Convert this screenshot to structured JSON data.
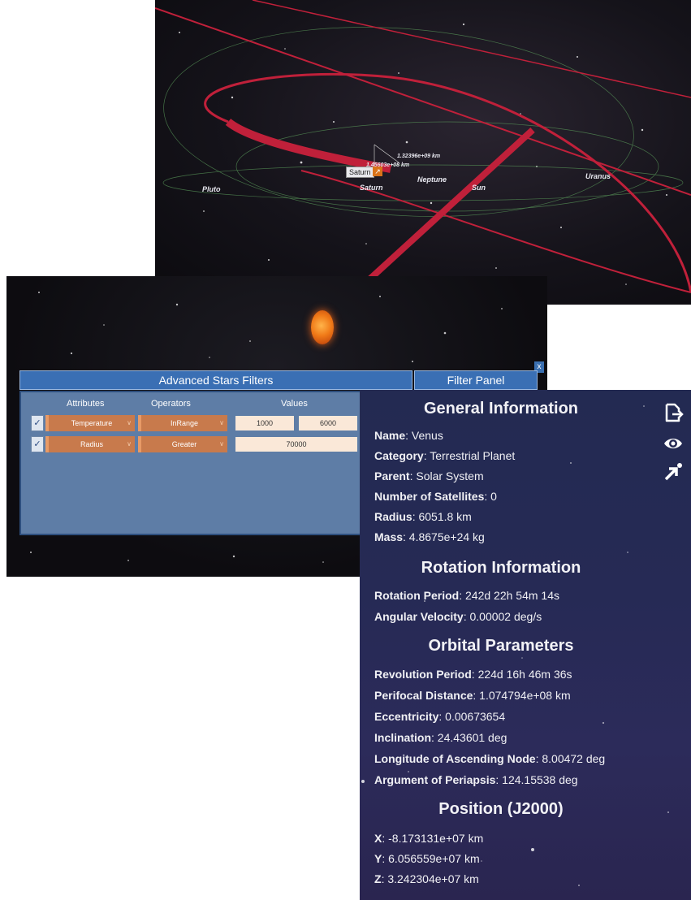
{
  "solar_view": {
    "planets": [
      "Pluto",
      "Saturn",
      "Neptune",
      "Sun",
      "Uranus"
    ],
    "selected_tag": "Saturn",
    "distance_1": "1.32396e+09 km",
    "distance_2": "1.45603e+08 km",
    "colors": {
      "orbit": "#c0203a",
      "faint_orbit": "#5a9a5a"
    }
  },
  "filters": {
    "title": "Advanced Stars Filters",
    "panel_button": "Filter Panel",
    "close": "x",
    "columns": [
      "Attributes",
      "Operators",
      "Values"
    ],
    "rows": [
      {
        "checked": "✓",
        "attribute": "Temperature",
        "operator": "InRange",
        "value1": "1000",
        "value2": "6000"
      },
      {
        "checked": "✓",
        "attribute": "Radius",
        "operator": "Greater",
        "value1": "70000"
      }
    ],
    "colors": {
      "header": "#3a6fb4",
      "body": "#5e7da6",
      "select": "#c87a4c"
    }
  },
  "info": {
    "general_title": "General Information",
    "general": [
      {
        "label": "Name",
        "value": ": Venus"
      },
      {
        "label": "Category",
        "value": ": Terrestrial Planet"
      },
      {
        "label": "Parent",
        "value": ": Solar System"
      },
      {
        "label": "Number of Satellites",
        "value": ": 0"
      },
      {
        "label": "Radius",
        "value": ": 6051.8 km"
      },
      {
        "label": "Mass",
        "value": ": 4.8675e+24 kg"
      }
    ],
    "rotation_title": "Rotation Information",
    "rotation": [
      {
        "label": "Rotation Period",
        "value": ": 242d 22h 54m 14s"
      },
      {
        "label": "Angular Velocity",
        "value": ": 0.00002 deg/s"
      }
    ],
    "orbital_title": "Orbital Parameters",
    "orbital": [
      {
        "label": "Revolution Period",
        "value": ": 224d 16h 46m 36s"
      },
      {
        "label": "Perifocal Distance",
        "value": ": 1.074794e+08 km"
      },
      {
        "label": "Eccentricity",
        "value": ": 0.00673654"
      },
      {
        "label": "Inclination",
        "value": ": 24.43601 deg"
      },
      {
        "label": "Longitude of Ascending Node",
        "value": ": 8.00472 deg"
      },
      {
        "label": "Argument of Periapsis",
        "value": ": 124.15538 deg"
      }
    ],
    "position_title": "Position (J2000)",
    "position": [
      {
        "label": "X",
        "value": ": -8.173131e+07 km"
      },
      {
        "label": "Y",
        "value": ": 6.056559e+07 km"
      },
      {
        "label": "Z",
        "value": ": 3.242304e+07 km"
      }
    ],
    "icons": [
      "export-icon",
      "eye-icon",
      "goto-icon"
    ]
  }
}
